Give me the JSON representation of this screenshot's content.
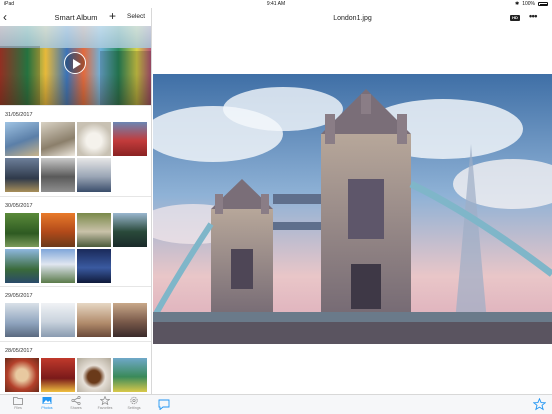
{
  "status_bar": {
    "device": "iPad",
    "time": "9:41 AM",
    "battery": "100%"
  },
  "album": {
    "title": "Smart Album",
    "select_label": "Select",
    "sections": [
      {
        "date": "31/05/2017",
        "count": 7
      },
      {
        "date": "30/05/2017",
        "count": 7
      },
      {
        "date": "29/05/2017",
        "count": 4
      },
      {
        "date": "28/05/2017",
        "count": 4
      }
    ]
  },
  "viewer": {
    "file_name": "London1.jpg",
    "hd_label": "HD"
  },
  "tabs": [
    {
      "label": "Files",
      "icon": "folder-icon",
      "active": false
    },
    {
      "label": "Photos",
      "icon": "photo-icon",
      "active": true
    },
    {
      "label": "Shares",
      "icon": "share-icon",
      "active": false
    },
    {
      "label": "Favorites",
      "icon": "star-icon",
      "active": false
    },
    {
      "label": "Settings",
      "icon": "gear-icon",
      "active": false
    }
  ],
  "colors": {
    "accent": "#2196f3",
    "tab_inactive": "#888888"
  }
}
